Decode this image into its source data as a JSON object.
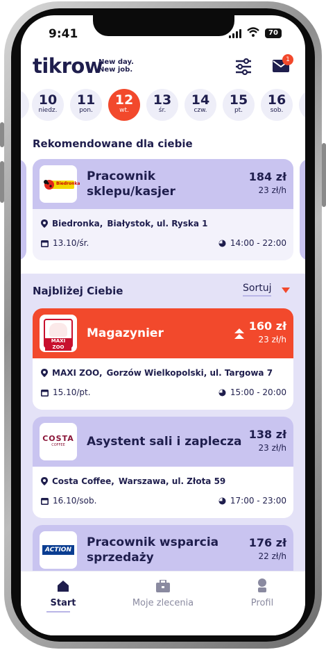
{
  "status_bar": {
    "time": "9:41",
    "battery": "70"
  },
  "header": {
    "logo": "tikrow",
    "tagline_1": "New day.",
    "tagline_2": "New job.",
    "mail_badge": "1"
  },
  "dates": [
    {
      "num": "10",
      "day": "niedz."
    },
    {
      "num": "11",
      "day": "pon."
    },
    {
      "num": "12",
      "day": "wt.",
      "active": true
    },
    {
      "num": "13",
      "day": "śr."
    },
    {
      "num": "14",
      "day": "czw."
    },
    {
      "num": "15",
      "day": "pt."
    },
    {
      "num": "16",
      "day": "sob."
    }
  ],
  "recommended": {
    "title": "Rekomendowane dla ciebie",
    "card": {
      "logo_text": "Biedronka",
      "job": "Pracownik sklepu/kasjer",
      "price": "184 zł",
      "rate": "23 zł/h",
      "location_brand": "Biedronka,",
      "location_addr": "Białystok, ul. Ryska 1",
      "date": "13.10/śr.",
      "hours": "14:00 - 22:00"
    }
  },
  "nearby": {
    "title": "Najbliżej Ciebie",
    "sort_label": "Sortuj",
    "cards": [
      {
        "logo_text": "MAXI ZOO",
        "job": "Magazynier",
        "price": "160 zł",
        "rate": "23 zł/h",
        "location_brand": "MAXI ZOO,",
        "location_addr": "Gorzów Wielkopolski, ul. Targowa 7",
        "date": "15.10/pt.",
        "hours": "15:00 - 20:00"
      },
      {
        "logo_text": "COSTA",
        "logo_sub": "COFFEE",
        "job": "Asystent sali i zaplecza",
        "price": "138 zł",
        "rate": "23 zł/h",
        "location_brand": "Costa Coffee,",
        "location_addr": "Warszawa, ul. Złota 59",
        "date": "16.10/sob.",
        "hours": "17:00 - 23:00"
      },
      {
        "logo_text": "ACTION",
        "job": "Pracownik wsparcia sprzedaży",
        "price": "176 zł",
        "rate": "22 zł/h"
      }
    ]
  },
  "tabs": [
    {
      "label": "Start",
      "icon": "home-icon",
      "active": true
    },
    {
      "label": "Moje zlecenia",
      "icon": "briefcase-icon"
    },
    {
      "label": "Profil",
      "icon": "profile-icon"
    }
  ],
  "colors": {
    "accent": "#f2492c",
    "lavender": "#c9c4f0",
    "navy": "#1f1e4d",
    "nearby_bg": "#e4e2f7"
  }
}
